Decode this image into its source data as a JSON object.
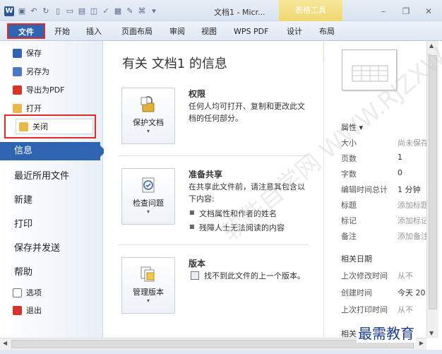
{
  "window": {
    "title": "文档1 - Micr...",
    "contextual_group": "表格工具"
  },
  "tabs": [
    "文件",
    "开始",
    "插入",
    "页面布局",
    "审阅",
    "视图",
    "WPS PDF",
    "设计",
    "布局"
  ],
  "nav": {
    "small_items": [
      {
        "label": "保存",
        "icon": "save-icon"
      },
      {
        "label": "另存为",
        "icon": "save-as-icon"
      },
      {
        "label": "导出为PDF",
        "icon": "pdf-icon"
      },
      {
        "label": "打开",
        "icon": "open-folder-icon"
      },
      {
        "label": "关闭",
        "icon": "close-folder-icon"
      }
    ],
    "selected": "信息",
    "big_items": [
      "最近所用文件",
      "新建",
      "打印",
      "保存并发送",
      "帮助"
    ],
    "bottom_items": [
      {
        "label": "选项",
        "icon": "options-icon"
      },
      {
        "label": "退出",
        "icon": "exit-icon"
      }
    ]
  },
  "main": {
    "title": "有关 文档1 的信息",
    "sections": [
      {
        "button_label": "保护文档",
        "icon": "lock-icon",
        "heading": "权限",
        "text": "任何人均可打开、复制和更改此文档的任何部分。",
        "bullets": []
      },
      {
        "button_label": "检查问题",
        "icon": "check-document-icon",
        "heading": "准备共享",
        "text": "在共享此文件前，请注意其包含以下内容:",
        "bullets": [
          "文档属性和作者的姓名",
          "残障人士无法阅读的内容"
        ]
      },
      {
        "button_label": "管理版本",
        "icon": "versions-icon",
        "heading": "版本",
        "text": "找不到此文件的上一个版本。",
        "bullets": []
      }
    ]
  },
  "properties": {
    "heading": "属性 ▾",
    "rows": [
      {
        "key": "大小",
        "value": "尚未保存"
      },
      {
        "key": "页数",
        "value": "1"
      },
      {
        "key": "字数",
        "value": "0"
      },
      {
        "key": "编辑时间总计",
        "value": "1 分钟"
      },
      {
        "key": "标题",
        "value": "添加标题"
      },
      {
        "key": "标记",
        "value": "添加标记"
      },
      {
        "key": "备注",
        "value": "添加备注"
      }
    ],
    "dates_heading": "相关日期",
    "date_rows": [
      {
        "key": "上次修改时间",
        "value": "从不"
      },
      {
        "key": "创建时间",
        "value": "今天 20"
      },
      {
        "key": "上次打印时间",
        "value": "从不"
      }
    ],
    "people_heading": "相关人员"
  },
  "watermark": "软件自学网 WWW.RJZXW.COM",
  "corner_brand": "最需教育"
}
